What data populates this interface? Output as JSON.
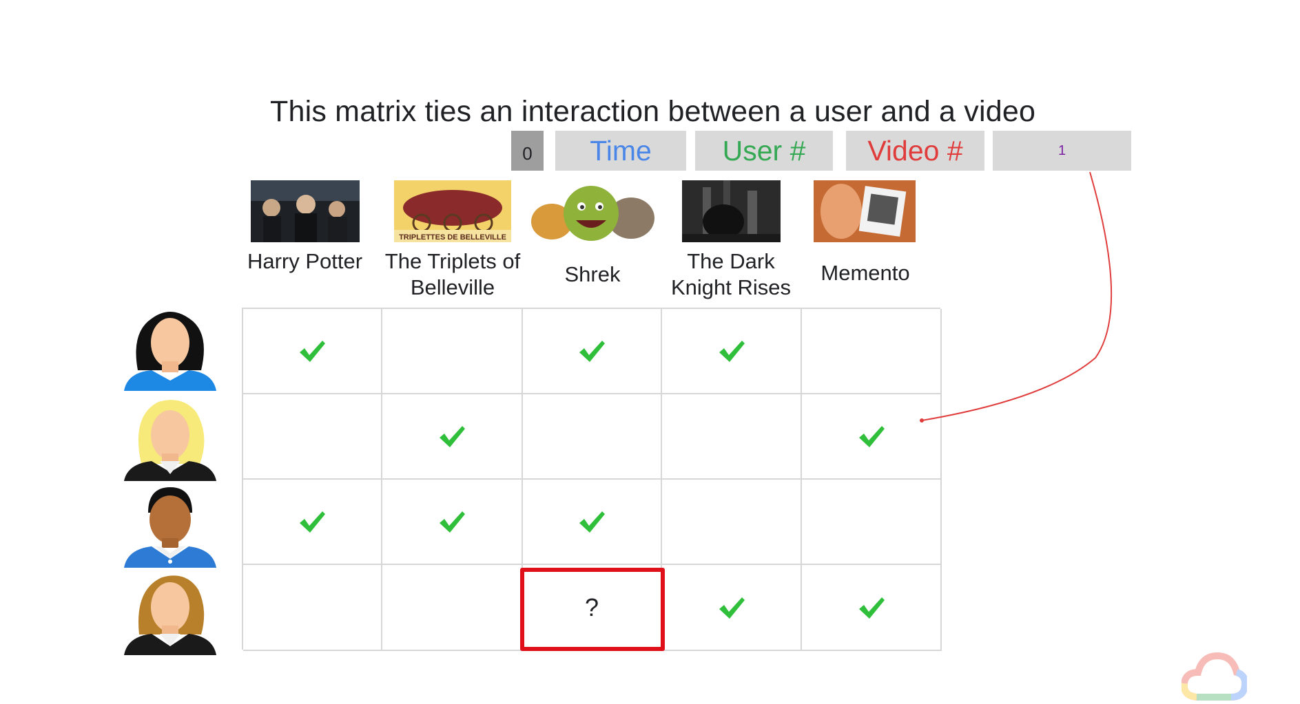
{
  "title": "This matrix ties an interaction between a user and a video",
  "header_cells": {
    "zero": "0",
    "time": "Time",
    "user": "User #",
    "video": "Video #",
    "one": "1"
  },
  "movies": [
    {
      "label": "Harry Potter"
    },
    {
      "label": "The Triplets of Belleville",
      "poster_text": "TRIPLETTES DE BELLEVILLE"
    },
    {
      "label": "Shrek"
    },
    {
      "label": "The Dark Knight Rises"
    },
    {
      "label": "Memento"
    }
  ],
  "users": [
    "user-1",
    "user-2",
    "user-3",
    "user-4"
  ],
  "matrix": [
    [
      true,
      false,
      true,
      true,
      false
    ],
    [
      false,
      true,
      false,
      false,
      true
    ],
    [
      true,
      true,
      true,
      false,
      false
    ],
    [
      false,
      false,
      "?",
      true,
      true
    ]
  ],
  "colors": {
    "check": "#2fbf3a",
    "highlight": "#e0101a",
    "arrow": "#e03c3c",
    "time": "#4a86e8",
    "user": "#34a853",
    "video": "#e03c3c"
  }
}
